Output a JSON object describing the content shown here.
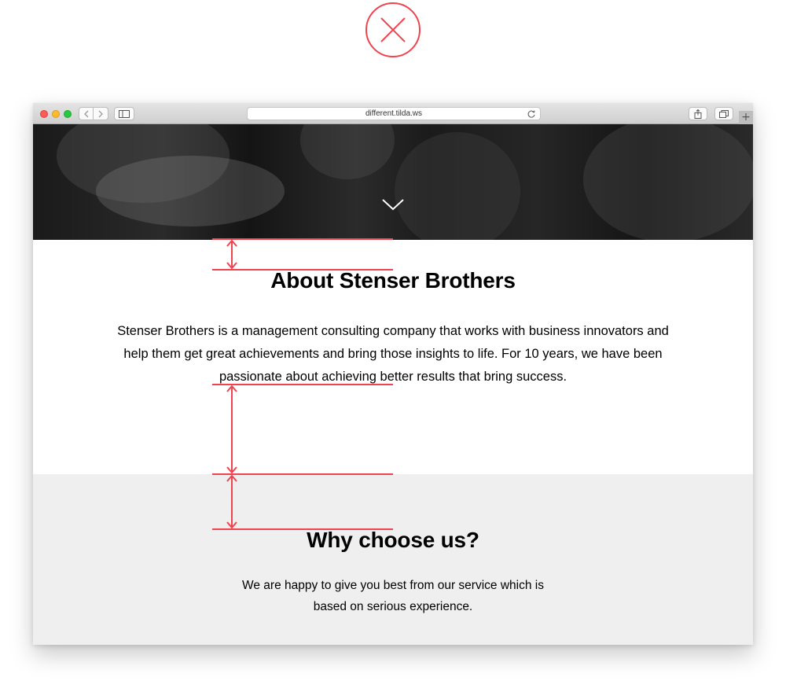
{
  "status_icon": "close-icon",
  "browser": {
    "url": "different.tilda.ws",
    "new_tab_label": "+"
  },
  "hero": {
    "scroll_icon": "chevron-down-icon"
  },
  "about": {
    "title": "About Stenser Brothers",
    "text": "Stenser Brothers is a management consulting company that works with business innovators and help them get great achievements and bring those insights to life. For 10 years, we have been passionate about achieving better results that bring success."
  },
  "why": {
    "title": "Why choose us?",
    "text": "We are happy to give you best from our service which is based on serious experience."
  },
  "colors": {
    "annotation_red": "#f0434f",
    "section_gray": "#efefef"
  }
}
